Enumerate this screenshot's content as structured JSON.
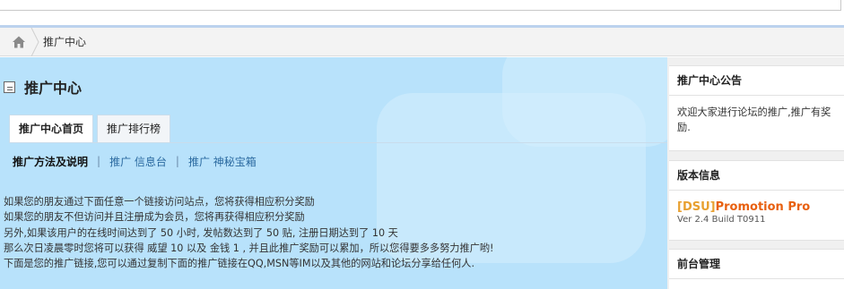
{
  "breadcrumb": {
    "home_icon": "home-icon",
    "current": "推广中心"
  },
  "main": {
    "title": "推广中心",
    "title_icon": "document-icon",
    "tabs": [
      {
        "label": "推广中心首页",
        "active": true
      },
      {
        "label": "推广排行榜",
        "active": false
      }
    ],
    "subnav": {
      "current": "推广方法及说明",
      "separator": "|",
      "links": [
        "推广 信息台",
        "推广 神秘宝箱"
      ]
    },
    "paragraphs": [
      "如果您的朋友通过下面任意一个链接访问站点，您将获得相应积分奖励",
      "如果您的朋友不但访问并且注册成为会员，您将再获得相应积分奖励",
      "另外,如果该用户的在线时间达到了  50 小时, 发帖数达到了  50 贴, 注册日期达到了  10 天",
      "那么次日凌晨零时您将可以获得  威望  10 以及  金钱  1 , 并且此推广奖励可以累加，所以您得要多多努力推广哟!",
      "下面是您的推广链接,您可以通过复制下面的推广链接在QQ,MSN等IM以及其他的网站和论坛分享给任何人."
    ]
  },
  "sidebar": {
    "notice": {
      "title": "推广中心公告",
      "body": "欢迎大家进行论坛的推广,推广有奖励."
    },
    "version": {
      "title": "版本信息",
      "product_bracket": "[DSU]",
      "product_name": "Promotion Pro",
      "build": "Ver 2.4 Build T0911"
    },
    "admin": {
      "title": "前台管理"
    }
  },
  "colors": {
    "main_bg": "#b8e2fb",
    "link": "#2b6aa0",
    "product_accent": "#e86010"
  }
}
